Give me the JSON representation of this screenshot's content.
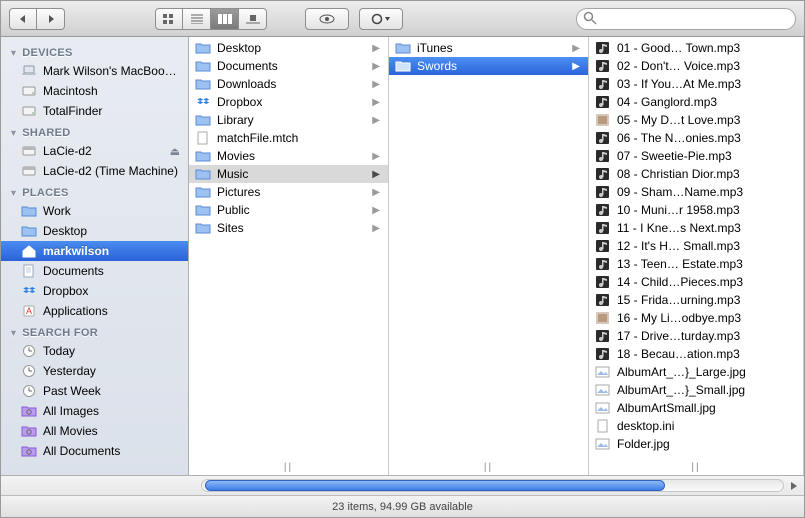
{
  "search": {
    "placeholder": ""
  },
  "sidebar": {
    "sections": [
      {
        "label": "DEVICES",
        "items": [
          {
            "label": "Mark Wilson's MacBook Pro",
            "icon": "laptop"
          },
          {
            "label": "Macintosh",
            "icon": "hdd"
          },
          {
            "label": "TotalFinder",
            "icon": "hdd"
          }
        ]
      },
      {
        "label": "SHARED",
        "items": [
          {
            "label": "LaCie-d2",
            "icon": "ext",
            "eject": true
          },
          {
            "label": "LaCie-d2 (Time Machine)",
            "icon": "ext"
          }
        ]
      },
      {
        "label": "PLACES",
        "items": [
          {
            "label": "Work",
            "icon": "folder"
          },
          {
            "label": "Desktop",
            "icon": "folder"
          },
          {
            "label": "markwilson",
            "icon": "home",
            "selected": true
          },
          {
            "label": "Documents",
            "icon": "doc"
          },
          {
            "label": "Dropbox",
            "icon": "dropbox"
          },
          {
            "label": "Applications",
            "icon": "apps"
          }
        ]
      },
      {
        "label": "SEARCH FOR",
        "items": [
          {
            "label": "Today",
            "icon": "clock"
          },
          {
            "label": "Yesterday",
            "icon": "clock"
          },
          {
            "label": "Past Week",
            "icon": "clock"
          },
          {
            "label": "All Images",
            "icon": "smart"
          },
          {
            "label": "All Movies",
            "icon": "smart"
          },
          {
            "label": "All Documents",
            "icon": "smart"
          }
        ]
      }
    ]
  },
  "columns": {
    "c1": [
      {
        "label": "Desktop",
        "icon": "folder",
        "arrow": true
      },
      {
        "label": "Documents",
        "icon": "folder",
        "arrow": true
      },
      {
        "label": "Downloads",
        "icon": "folder",
        "arrow": true
      },
      {
        "label": "Dropbox",
        "icon": "dropbox",
        "arrow": true
      },
      {
        "label": "Library",
        "icon": "folder",
        "arrow": true
      },
      {
        "label": "matchFile.mtch",
        "icon": "file",
        "arrow": false
      },
      {
        "label": "Movies",
        "icon": "folder",
        "arrow": true
      },
      {
        "label": "Music",
        "icon": "folder",
        "arrow": true,
        "sel": "grey"
      },
      {
        "label": "Pictures",
        "icon": "folder",
        "arrow": true
      },
      {
        "label": "Public",
        "icon": "folder",
        "arrow": true
      },
      {
        "label": "Sites",
        "icon": "folder",
        "arrow": true
      }
    ],
    "c2": [
      {
        "label": "iTunes",
        "icon": "folder",
        "arrow": true
      },
      {
        "label": "Swords",
        "icon": "folder",
        "arrow": true,
        "sel": "blue"
      }
    ],
    "c3": [
      {
        "label": "01 - Good… Town.mp3",
        "icon": "mp3"
      },
      {
        "label": "02 - Don't… Voice.mp3",
        "icon": "mp3"
      },
      {
        "label": "03 - If You…At Me.mp3",
        "icon": "mp3"
      },
      {
        "label": "04 - Ganglord.mp3",
        "icon": "mp3"
      },
      {
        "label": "05 - My D…t Love.mp3",
        "icon": "art"
      },
      {
        "label": "06 - The N…onies.mp3",
        "icon": "mp3"
      },
      {
        "label": "07 - Sweetie-Pie.mp3",
        "icon": "mp3"
      },
      {
        "label": "08 - Christian Dior.mp3",
        "icon": "mp3"
      },
      {
        "label": "09 - Sham…Name.mp3",
        "icon": "mp3"
      },
      {
        "label": "10 - Muni…r 1958.mp3",
        "icon": "mp3"
      },
      {
        "label": "11 - I Kne…s Next.mp3",
        "icon": "mp3"
      },
      {
        "label": "12 - It's H… Small.mp3",
        "icon": "mp3"
      },
      {
        "label": "13 - Teen… Estate.mp3",
        "icon": "mp3"
      },
      {
        "label": "14 - Child…Pieces.mp3",
        "icon": "mp3"
      },
      {
        "label": "15 - Frida…urning.mp3",
        "icon": "mp3"
      },
      {
        "label": "16 - My Li…odbye.mp3",
        "icon": "art"
      },
      {
        "label": "17 - Drive…turday.mp3",
        "icon": "mp3"
      },
      {
        "label": "18 - Becau…ation.mp3",
        "icon": "mp3"
      },
      {
        "label": "AlbumArt_…}_Large.jpg",
        "icon": "img"
      },
      {
        "label": "AlbumArt_…}_Small.jpg",
        "icon": "img"
      },
      {
        "label": "AlbumArtSmall.jpg",
        "icon": "img"
      },
      {
        "label": "desktop.ini",
        "icon": "file"
      },
      {
        "label": "Folder.jpg",
        "icon": "img"
      }
    ]
  },
  "status": "23 items, 94.99 GB available"
}
